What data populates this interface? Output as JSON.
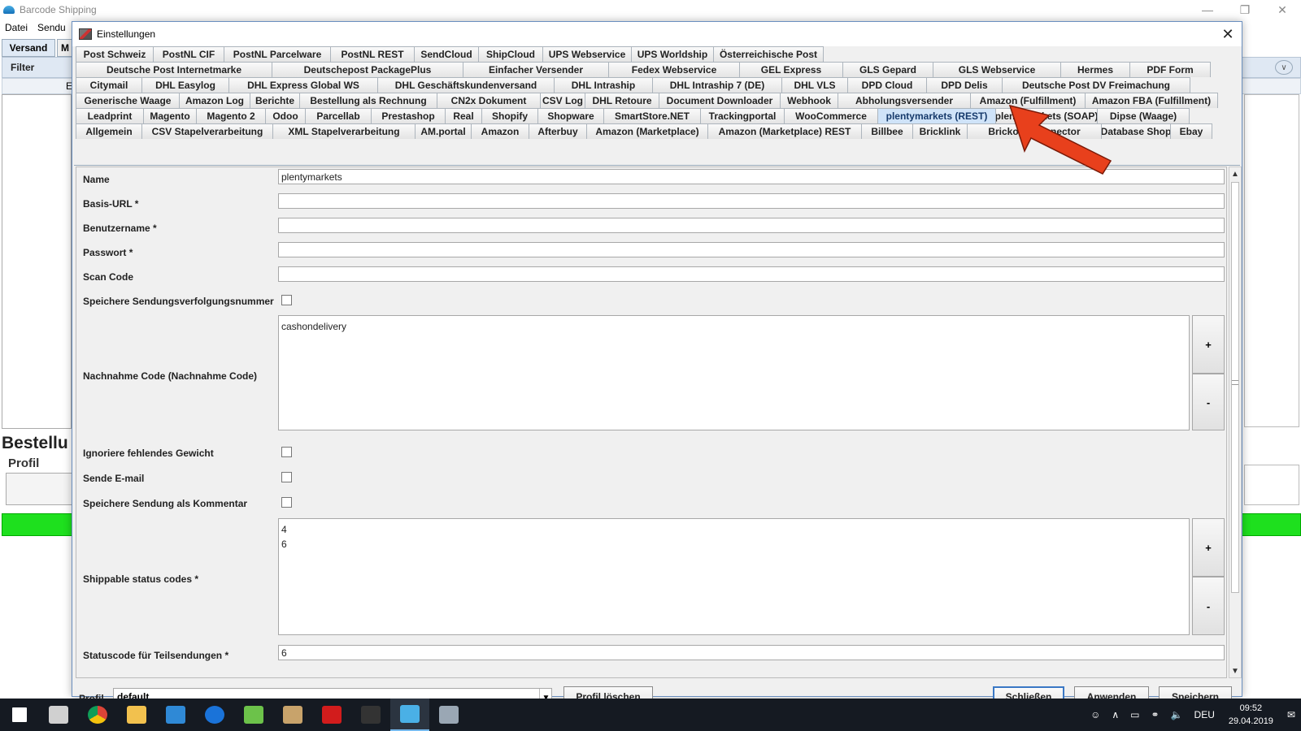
{
  "app": {
    "title": "Barcode Shipping",
    "menu": [
      "Datei",
      "Sendu"
    ],
    "tab_versand": "Versand",
    "tab_more": "M",
    "filter_label": "Filter",
    "header_fragment": "E",
    "bestellungen_fragment": "Bestellu",
    "profil_label": "Profil",
    "window_controls": [
      "minimize-icon",
      "restore-icon",
      "close-icon"
    ]
  },
  "dialog": {
    "title": "Einstellungen",
    "close_symbol": "✕",
    "tab_rows": [
      [
        "Post Schweiz",
        "PostNL CIF",
        "PostNL Parcelware",
        "PostNL REST",
        "SendCloud",
        "ShipCloud",
        "UPS Webservice",
        "UPS Worldship",
        "Österreichische Post"
      ],
      [
        "Deutsche Post Internetmarke",
        "Deutschepost PackagePlus",
        "Einfacher Versender",
        "Fedex Webservice",
        "GEL Express",
        "GLS Gepard",
        "GLS Webservice",
        "Hermes",
        "PDF Form"
      ],
      [
        "Citymail",
        "DHL Easylog",
        "DHL Express Global WS",
        "DHL Geschäftskundenversand",
        "DHL Intraship",
        "DHL Intraship 7 (DE)",
        "DHL VLS",
        "DPD Cloud",
        "DPD Delis",
        "Deutsche Post DV Freimachung"
      ],
      [
        "Generische Waage",
        "Amazon Log",
        "Berichte",
        "Bestellung als Rechnung",
        "CN2x Dokument",
        "CSV Log",
        "DHL Retoure",
        "Document Downloader",
        "Webhook",
        "Abholungsversender",
        "Amazon (Fulfillment)",
        "Amazon FBA (Fulfillment)"
      ],
      [
        "Leadprint",
        "Magento",
        "Magento 2",
        "Odoo",
        "Parcellab",
        "Prestashop",
        "Real",
        "Shopify",
        "Shopware",
        "SmartStore.NET",
        "Trackingportal",
        "WooCommerce",
        "plentymarkets (REST)",
        "plentymarkets (SOAP)",
        "Dipse (Waage)"
      ],
      [
        "Allgemein",
        "CSV Stapelverarbeitung",
        "XML Stapelverarbeitung",
        "AM.portal",
        "Amazon",
        "Afterbuy",
        "Amazon (Marketplace)",
        "Amazon (Marketplace) REST",
        "Billbee",
        "Bricklink",
        "Brickowl Connector",
        "Database Shop",
        "Ebay"
      ]
    ],
    "active_tab": "plentymarkets (REST)",
    "form": {
      "name_label": "Name",
      "name_value": "plentymarkets",
      "basis_url_label": "Basis-URL *",
      "basis_url_value": "",
      "benutzername_label": "Benutzername *",
      "benutzername_value": "",
      "passwort_label": "Passwort *",
      "passwort_value": "",
      "scan_code_label": "Scan Code",
      "scan_code_value": "",
      "speichere_tracking_label": "Speichere Sendungsverfolgungsnummer",
      "speichere_tracking_checked": false,
      "nachnahme_label": "Nachnahme Code (Nachnahme Code)",
      "nachnahme_value": "cashondelivery",
      "ignoriere_gewicht_label": "Ignoriere fehlendes Gewicht",
      "ignoriere_gewicht_checked": false,
      "sende_email_label": "Sende E-mail",
      "sende_email_checked": false,
      "speichere_kommentar_label": "Speichere Sendung als Kommentar",
      "speichere_kommentar_checked": false,
      "shippable_label": "Shippable status codes *",
      "shippable_value": "4\n6",
      "teilsendungen_label": "Statuscode für Teilsendungen *",
      "teilsendungen_value": "6",
      "plus_label": "+",
      "minus_label": "-"
    },
    "footer": {
      "profil_label": "Profil",
      "profil_value": "default",
      "profil_loeschen": "Profil löschen",
      "schliessen": "Schließen",
      "anwenden": "Anwenden",
      "speichern": "Speichern"
    }
  },
  "annotation": {
    "arrow_color": "#e8401c",
    "target": "plentymarkets (REST)"
  },
  "taskbar": {
    "apps": [
      "windows-start-icon",
      "task-view-icon",
      "chrome-icon",
      "file-explorer-icon",
      "vscode-icon",
      "teamviewer-icon",
      "notepad-icon",
      "package-icon",
      "acrobat-icon",
      "terminal-icon",
      "barcode-shipping-icon",
      "paint-icon"
    ],
    "language": "DEU",
    "time": "09:52",
    "date": "29.04.2019"
  }
}
